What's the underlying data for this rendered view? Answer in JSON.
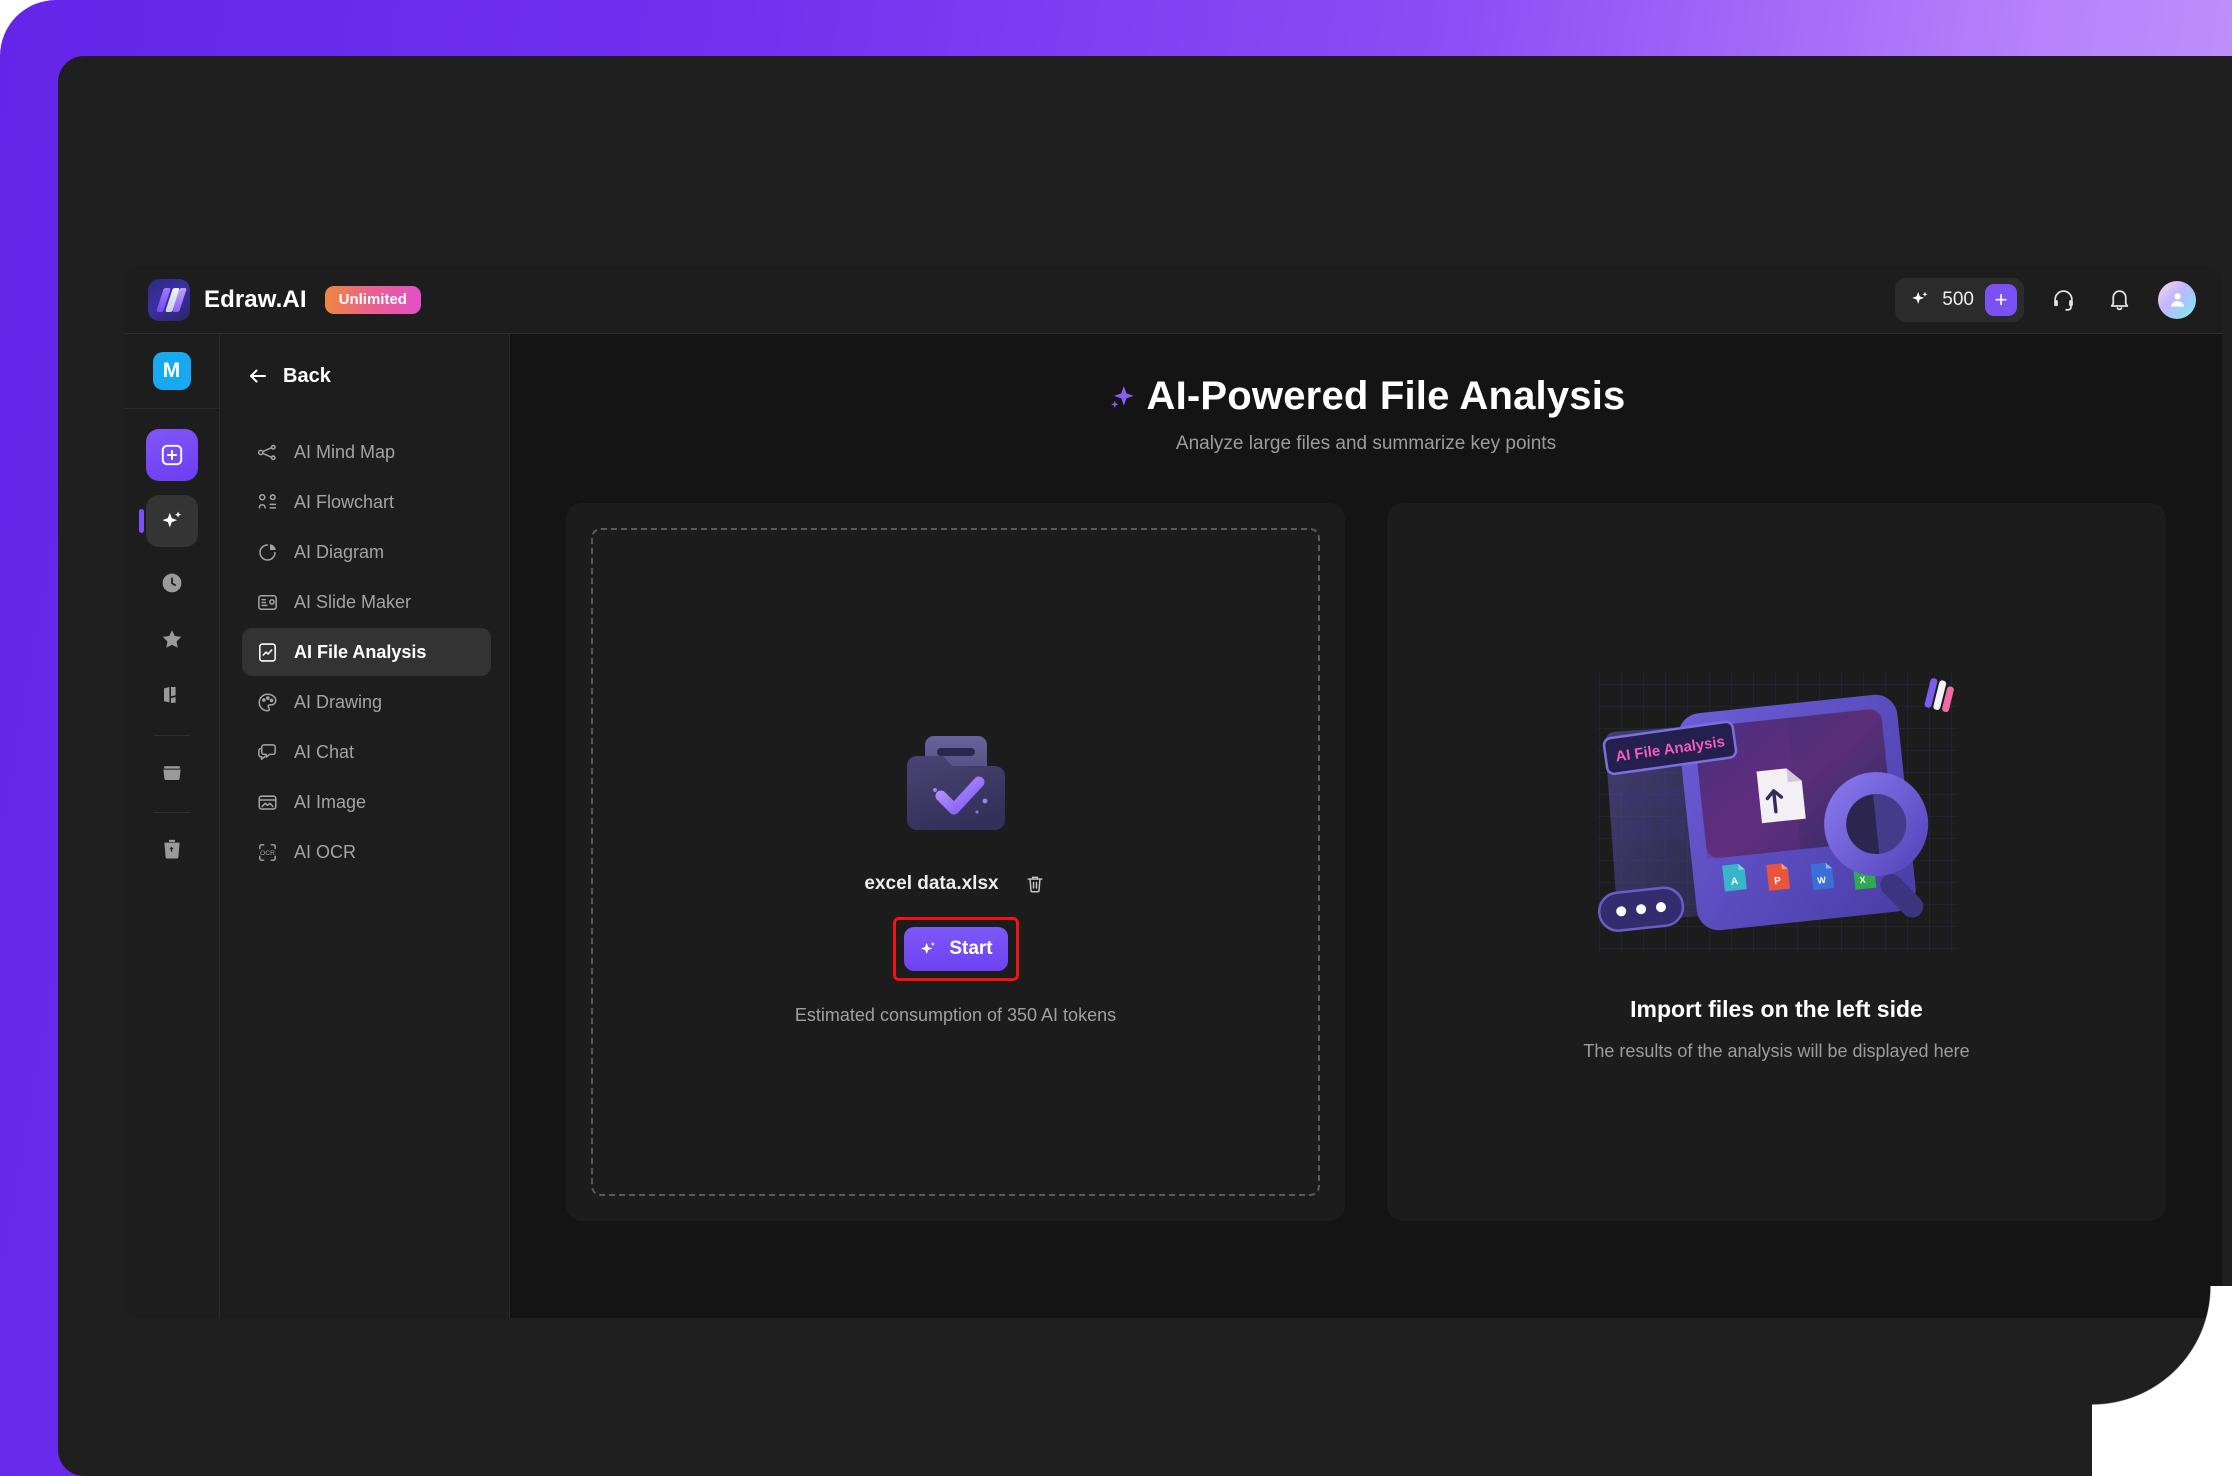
{
  "header": {
    "brand_name": "Edraw.AI",
    "plan_badge": "Unlimited",
    "token_count": "500",
    "add_label": "+",
    "support_icon": "headset-icon",
    "notification_icon": "bell-icon",
    "avatar_icon": "user-avatar"
  },
  "rail": {
    "workspace_badge": "M",
    "items": [
      {
        "name": "new",
        "icon": "plus-square-icon"
      },
      {
        "name": "ai",
        "icon": "sparkles-icon"
      },
      {
        "name": "recent",
        "icon": "clock-icon"
      },
      {
        "name": "favorites",
        "icon": "star-icon"
      },
      {
        "name": "templates",
        "icon": "templates-icon"
      },
      {
        "name": "files",
        "icon": "folder-icon"
      },
      {
        "name": "trash",
        "icon": "recycle-bin-icon"
      }
    ]
  },
  "nav": {
    "back_label": "Back",
    "items": [
      {
        "label": "AI Mind Map",
        "icon": "mind-map-icon"
      },
      {
        "label": "AI Flowchart",
        "icon": "flowchart-icon"
      },
      {
        "label": "AI Diagram",
        "icon": "pie-chart-icon"
      },
      {
        "label": "AI Slide Maker",
        "icon": "slide-icon"
      },
      {
        "label": "AI File Analysis",
        "icon": "file-analysis-icon"
      },
      {
        "label": "AI Drawing",
        "icon": "palette-icon"
      },
      {
        "label": "AI Chat",
        "icon": "chat-bubble-icon"
      },
      {
        "label": "AI Image",
        "icon": "image-icon"
      },
      {
        "label": "AI OCR",
        "icon": "ocr-icon"
      }
    ]
  },
  "main": {
    "title": "AI-Powered File Analysis",
    "subtitle": "Analyze large files and summarize key points",
    "upload": {
      "file_name": "excel data.xlsx",
      "delete_icon": "trash-icon",
      "start_label": "Start",
      "estimate_text": "Estimated consumption of 350 AI tokens"
    },
    "result": {
      "illustration_badge": "AI File Analysis",
      "title": "Import files on the left side",
      "subtitle": "The results of the analysis will be displayed here"
    }
  },
  "colors": {
    "accent": "#7a52f4",
    "frame_gradient_start": "#6425e8",
    "frame_gradient_end": "#c79dfd",
    "highlight_box": "#f41111",
    "workspace_badge": "#18a9f0"
  }
}
